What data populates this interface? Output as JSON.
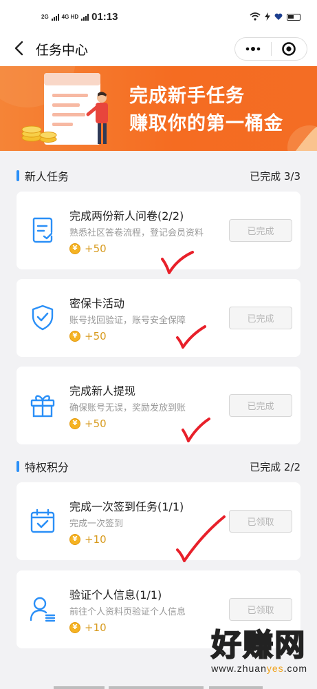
{
  "status_bar": {
    "net_1": "2G",
    "net_2": "4G HD",
    "time": "01:13"
  },
  "nav": {
    "title": "任务中心"
  },
  "banner": {
    "line1": "完成新手任务",
    "line2": "赚取你的第一桶金"
  },
  "sections": [
    {
      "title": "新人任务",
      "progress": "已完成 3/3",
      "tasks": [
        {
          "title": "完成两份新人问卷(2/2)",
          "desc": "熟悉社区答卷流程，登记会员资料",
          "reward": "+50",
          "button": "已完成",
          "icon": "questionnaire-icon"
        },
        {
          "title": "密保卡活动",
          "desc": "账号找回验证，账号安全保障",
          "reward": "+50",
          "button": "已完成",
          "icon": "shield-icon"
        },
        {
          "title": "完成新人提现",
          "desc": "确保账号无误，奖励发放到账",
          "reward": "+50",
          "button": "已完成",
          "icon": "gift-icon"
        }
      ]
    },
    {
      "title": "特权积分",
      "progress": "已完成 2/2",
      "tasks": [
        {
          "title": "完成一次签到任务(1/1)",
          "desc": "完成一次签到",
          "reward": "+10",
          "button": "已领取",
          "icon": "calendar-check-icon"
        },
        {
          "title": "验证个人信息(1/1)",
          "desc": "前往个人资料页验证个人信息",
          "reward": "+10",
          "button": "已领取",
          "icon": "user-info-icon"
        }
      ]
    }
  ],
  "coin_symbol": "¥",
  "watermark": {
    "main": "好赚网",
    "url_part1": "www.zhuan",
    "url_part2": "yes",
    "url_part3": ".com"
  },
  "colors": {
    "accent_blue": "#2a8ff7",
    "banner_orange": "#f56c21",
    "reward_gold": "#d79a1d",
    "check_red": "#e8202a"
  }
}
